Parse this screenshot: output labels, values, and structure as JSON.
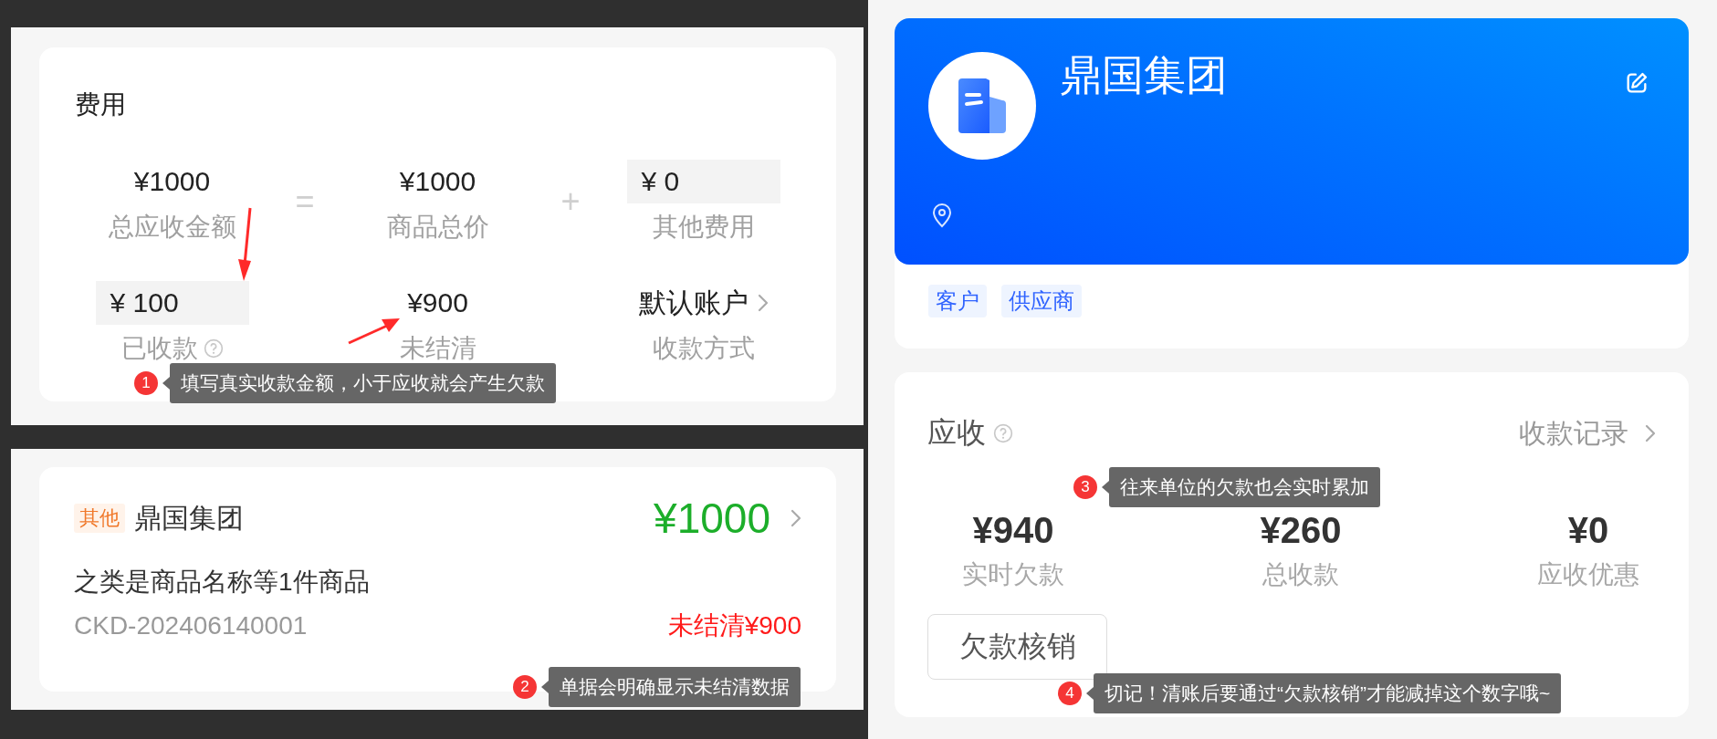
{
  "fee_card": {
    "title": "费用",
    "operators": [
      "=",
      "+"
    ],
    "rows": [
      [
        {
          "kind": "text",
          "value": "¥1000",
          "label": "总应收金额"
        },
        {
          "kind": "text",
          "value": "¥1000",
          "label": "商品总价"
        },
        {
          "kind": "input",
          "value": "¥ 0",
          "label": "其他费用"
        }
      ],
      [
        {
          "kind": "input",
          "value": "¥ 100",
          "label": "已收款",
          "help": true
        },
        {
          "kind": "text",
          "value": "¥900",
          "label": "未结清"
        },
        {
          "kind": "select",
          "value": "默认账户",
          "label": "收款方式"
        }
      ]
    ],
    "annotation": {
      "number": "1",
      "text": "填写真实收款金额，小于应收就会产生欠款"
    }
  },
  "order_card": {
    "tag": "其他",
    "customer": "鼎国集团",
    "amount": "¥1000",
    "description": "之类是商品名称等1件商品",
    "order_no": "CKD-202406140001",
    "unsettled": "未结清¥900",
    "annotation": {
      "number": "2",
      "text": "单据会明确显示未结清数据"
    }
  },
  "company_card": {
    "name": "鼎国集团",
    "tags": [
      "客户",
      "供应商"
    ]
  },
  "receivable_card": {
    "title": "应收",
    "help": true,
    "link": "收款记录",
    "stats": [
      {
        "value": "¥940",
        "label": "实时欠款"
      },
      {
        "value": "¥260",
        "label": "总收款"
      },
      {
        "value": "¥0",
        "label": "应收优惠"
      }
    ],
    "button": "欠款核销",
    "annotations": [
      {
        "number": "3",
        "text": "往来单位的欠款也会实时累加"
      },
      {
        "number": "4",
        "text": "切记！清账后要通过“欠款核销”才能减掉这个数字哦~"
      }
    ]
  }
}
